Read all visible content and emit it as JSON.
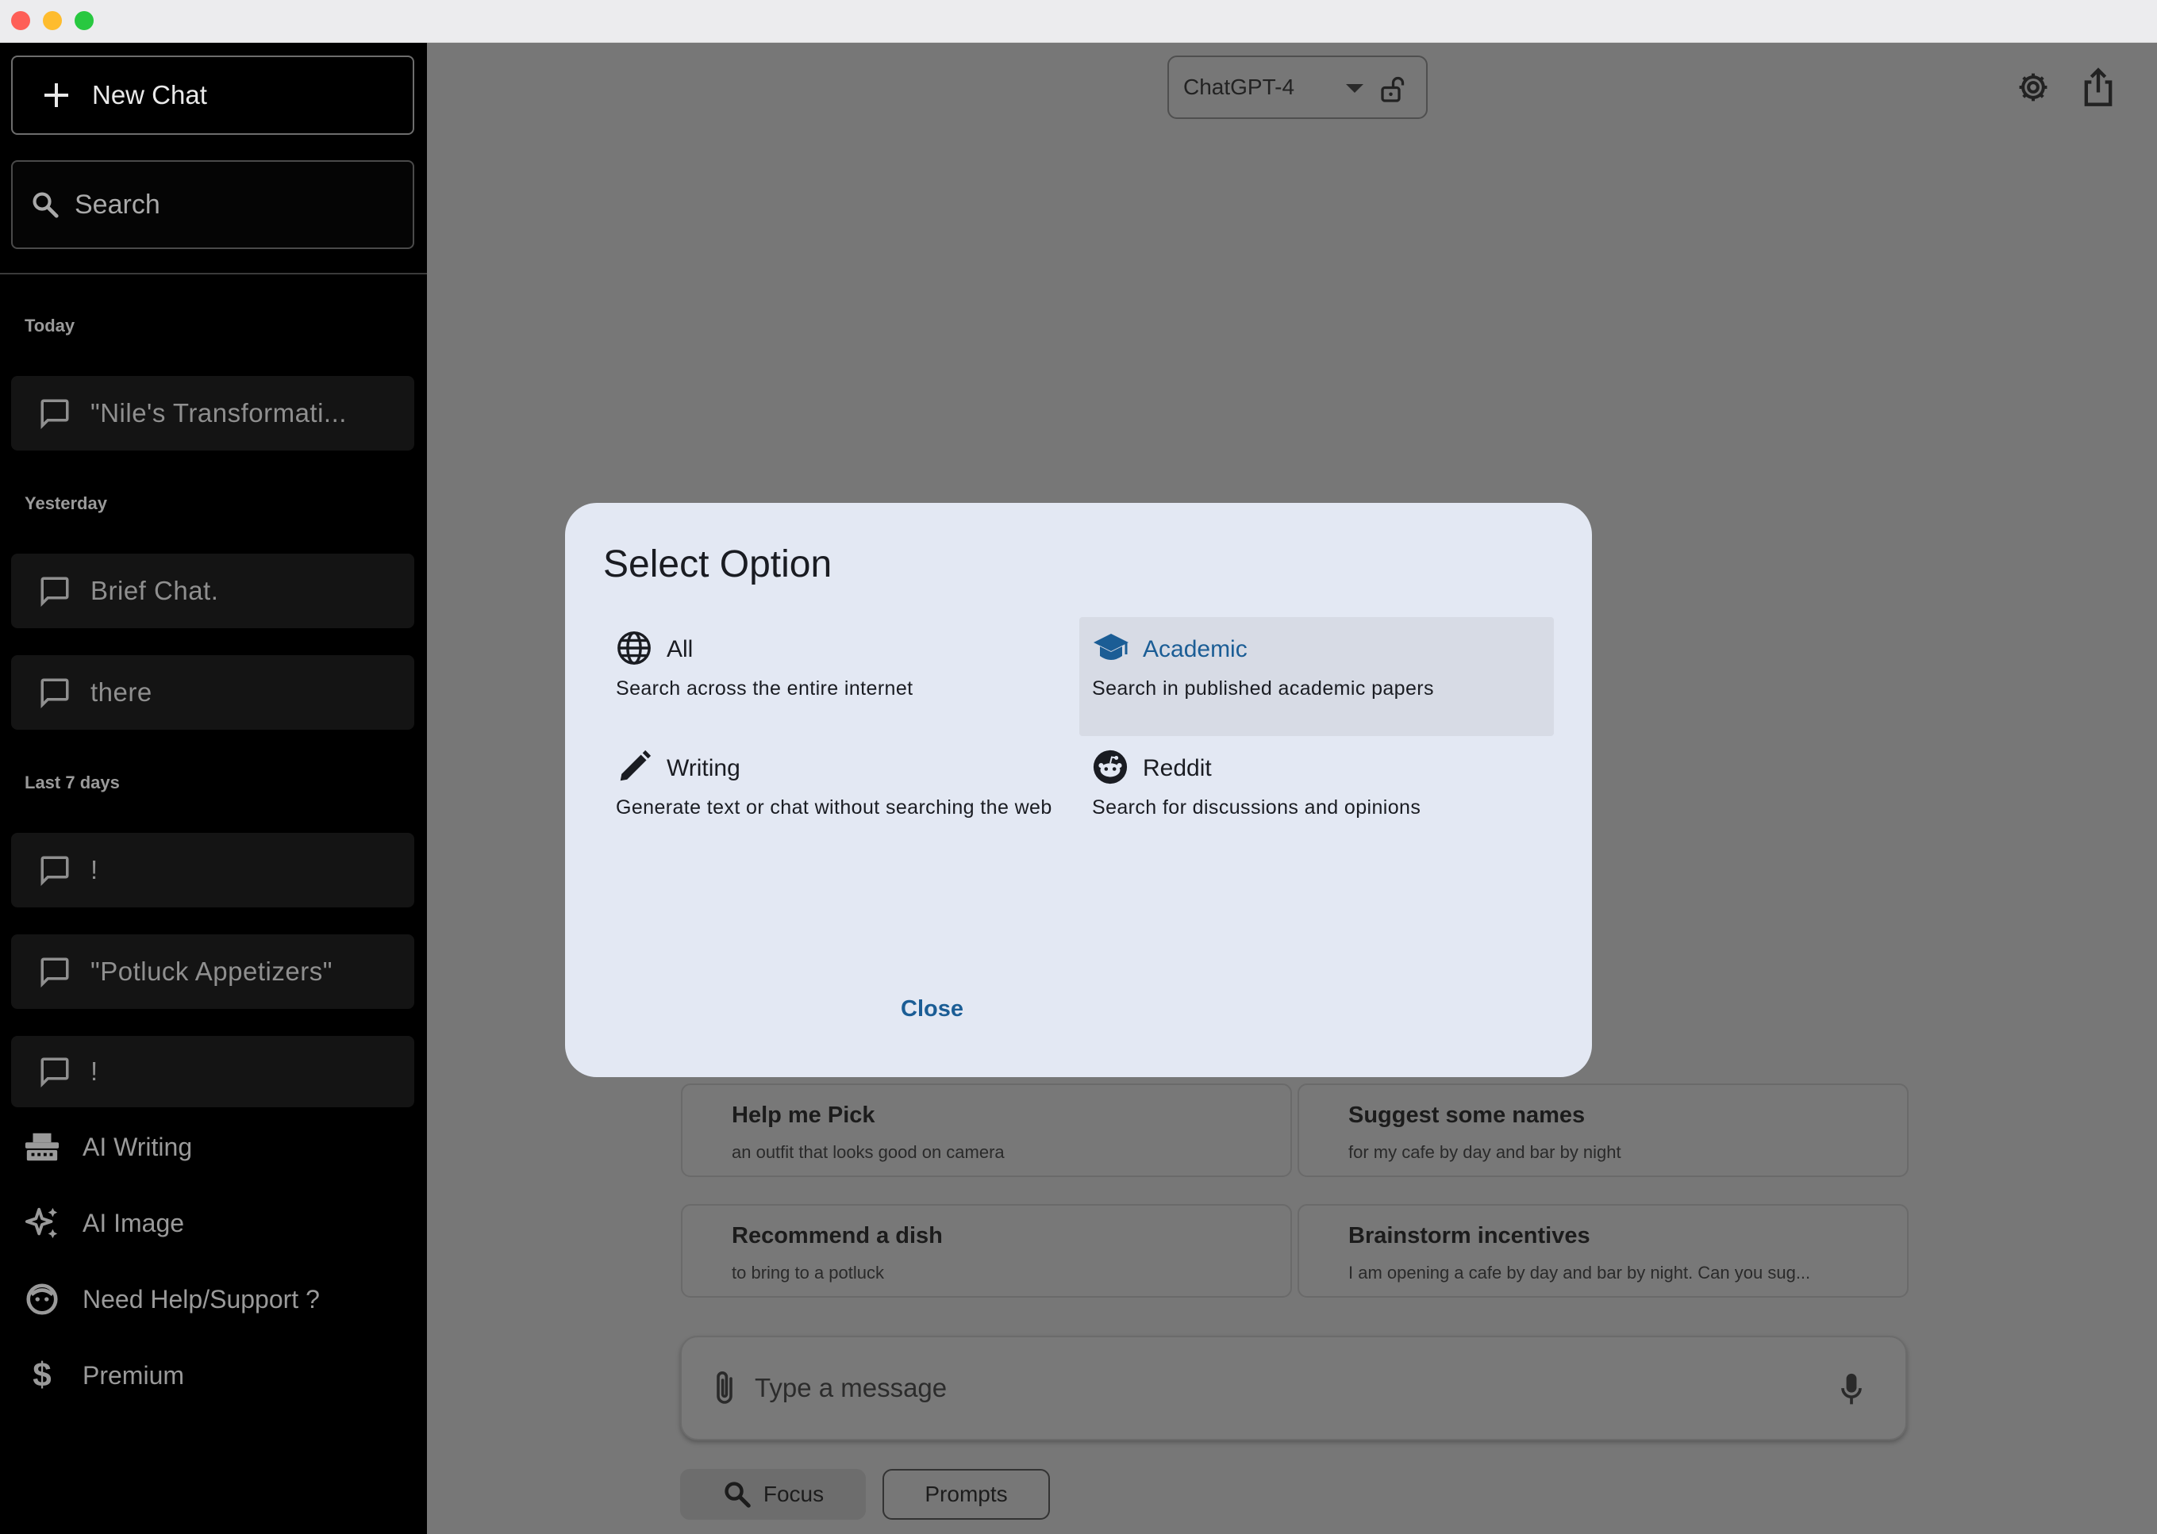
{
  "sidebar": {
    "new_chat_label": "New Chat",
    "search_placeholder": "Search",
    "sections": {
      "today": "Today",
      "yesterday": "Yesterday",
      "last7": "Last 7 days"
    },
    "chats": [
      "\"Nile's Transformati...",
      "Brief Chat.",
      "there",
      "!",
      "\"Potluck Appetizers\"",
      "!"
    ],
    "menu": [
      {
        "label": "AI Writing",
        "icon": "typewriter-icon"
      },
      {
        "label": "AI Image",
        "icon": "sparkle-icon"
      },
      {
        "label": "Need Help/Support ?",
        "icon": "support-icon"
      },
      {
        "label": "Premium",
        "icon": "dollar-icon"
      }
    ]
  },
  "header": {
    "model": "ChatGPT-4"
  },
  "suggestions": [
    {
      "title": "Help me Pick",
      "subtitle": "an outfit that looks good on camera"
    },
    {
      "title": "Suggest some names",
      "subtitle": "for my cafe by day and bar by night"
    },
    {
      "title": "Recommend a dish",
      "subtitle": "to bring to a potluck"
    },
    {
      "title": "Brainstorm incentives",
      "subtitle": "I am opening a cafe by day and bar by night. Can you sug..."
    }
  ],
  "composer": {
    "placeholder": "Type a message",
    "focus_label": "Focus",
    "prompts_label": "Prompts"
  },
  "dialog": {
    "title": "Select Option",
    "options": [
      {
        "name": "All",
        "description": "Search across the entire internet",
        "icon": "globe-icon",
        "selected": false
      },
      {
        "name": "Academic",
        "description": "Search in published academic papers",
        "icon": "graduation-cap-icon",
        "selected": true
      },
      {
        "name": "Writing",
        "description": "Generate text or chat without searching the web",
        "icon": "pencil-icon",
        "selected": false
      },
      {
        "name": "Reddit",
        "description": "Search for discussions and opinions",
        "icon": "reddit-icon",
        "selected": false
      }
    ],
    "close_label": "Close"
  },
  "colors": {
    "accent": "#1b5d95",
    "dialog_bg": "#e3e8f3",
    "sidebar_bg": "#000000",
    "overlay": "#777777"
  }
}
